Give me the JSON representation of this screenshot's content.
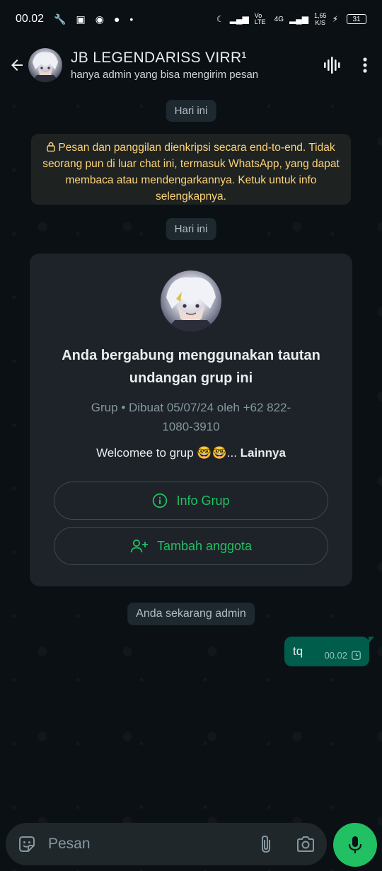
{
  "status_bar": {
    "time": "00.02",
    "network_label": "4G",
    "volte_label": "Vo LTE",
    "speed": "1,65",
    "speed_unit": "K/S",
    "battery": "31"
  },
  "header": {
    "title": "JB LEGENDARISS VIRR¹",
    "subtitle": "hanya admin yang bisa mengirim pesan"
  },
  "chat": {
    "date_chip_1": "Hari ini",
    "encryption_notice": "Pesan dan panggilan dienkripsi secara end-to-end. Tidak seorang pun di luar chat ini, termasuk WhatsApp, yang dapat membaca atau mendengarkannya. Ketuk untuk info selengkapnya.",
    "date_chip_2": "Hari ini",
    "group_card": {
      "title": "Anda bergabung menggunakan tautan undangan grup ini",
      "meta": "Grup • Dibuat 05/07/24 oleh +62 822-1080-3910",
      "description": "Welcomee to grup 🤓🤓...",
      "more_label": "Lainnya",
      "info_button": "Info Grup",
      "add_member_button": "Tambah anggota"
    },
    "system_chip": "Anda sekarang admin",
    "messages": [
      {
        "text": "tq",
        "time": "00.02"
      }
    ]
  },
  "input": {
    "placeholder": "Pesan"
  },
  "colors": {
    "accent": "#21c063",
    "outgoing_bubble": "#005c4b",
    "notice_text": "#ffd279",
    "background": "#0b1014"
  },
  "icons": [
    "back-arrow-icon",
    "waveform-icon",
    "more-vert-icon",
    "lock-icon",
    "info-icon",
    "add-person-icon",
    "clock-icon",
    "sticker-icon",
    "paperclip-icon",
    "camera-icon",
    "mic-icon"
  ]
}
